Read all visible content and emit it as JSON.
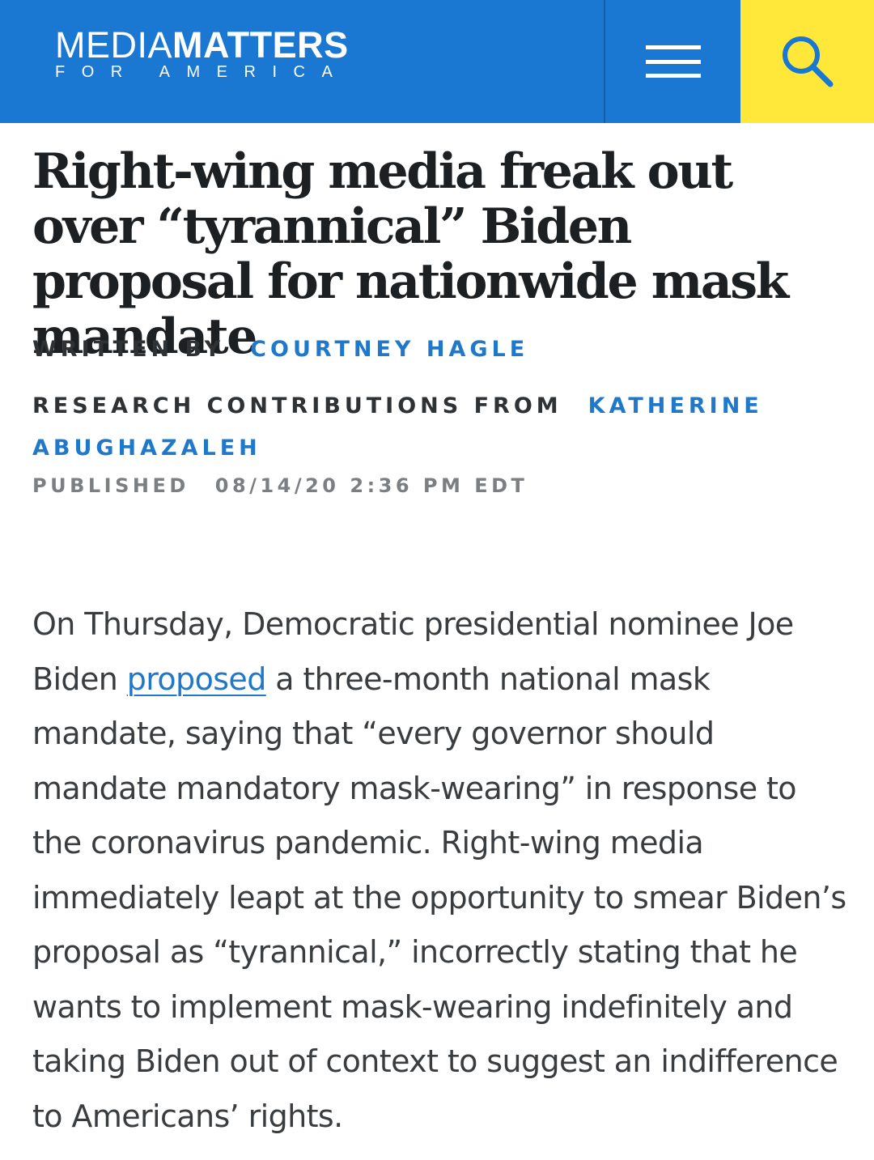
{
  "header": {
    "logo_light": "MEDIA",
    "logo_bold": "MATTERS",
    "logo_sub": "FOR AMERICA",
    "brand_blue": "#1a78d2",
    "search_yellow": "#ffe83a",
    "menu_icon": "hamburger-icon",
    "search_icon": "search-icon"
  },
  "article": {
    "headline": "Right-wing media freak out over “tyrannical” Biden proposal for nationwide mask mandate",
    "written_by_label": "WRITTEN BY",
    "author": "COURTNEY HAGLE",
    "research_label": "RESEARCH CONTRIBUTIONS FROM",
    "researcher_first": "KATHERINE",
    "researcher_last": "ABUGHAZALEH",
    "published_label": "PUBLISHED",
    "published_date": "08/14/20 2:36 PM EDT",
    "body_part1": "On Thursday, Democratic presidential nominee Joe Biden ",
    "body_link": "proposed",
    "body_part2": " a three-month national mask mandate, saying that “every governor should mandate mandatory mask-wearing” in response to the coronavirus pandemic. Right-wing media immediately leapt at the opportunity to smear Biden’s proposal as “tyrannical,” incorrectly stating that he wants to implement mask-wearing indefinitely and taking Biden out of context to suggest an indifference to Americans’ rights.",
    "link_color": "#1f78c9"
  }
}
